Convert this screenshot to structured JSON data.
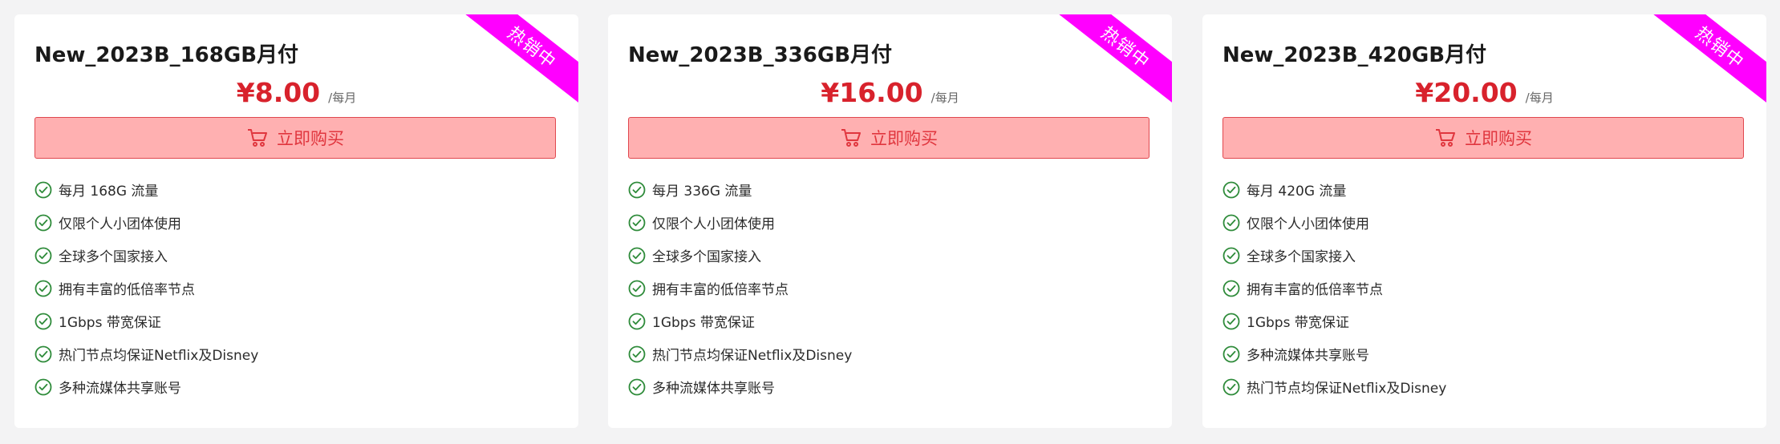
{
  "colors": {
    "accent": "#d8222c",
    "ribbon": "#ff00ff",
    "button_bg": "#ffb0b1",
    "check": "#2e8b3a"
  },
  "plans": [
    {
      "ribbon": "热销中",
      "title": "New_2023B_168GB月付",
      "price": "¥8.00",
      "unit": "/每月",
      "buy_label": "立即购买",
      "features": [
        "每月 168G 流量",
        "仅限个人小团体使用",
        "全球多个国家接入",
        "拥有丰富的低倍率节点",
        "1Gbps 带宽保证",
        "热门节点均保证Netflix及Disney",
        "多种流媒体共享账号"
      ]
    },
    {
      "ribbon": "热销中",
      "title": "New_2023B_336GB月付",
      "price": "¥16.00",
      "unit": "/每月",
      "buy_label": "立即购买",
      "features": [
        "每月 336G 流量",
        "仅限个人小团体使用",
        "全球多个国家接入",
        "拥有丰富的低倍率节点",
        "1Gbps 带宽保证",
        "热门节点均保证Netflix及Disney",
        "多种流媒体共享账号"
      ]
    },
    {
      "ribbon": "热销中",
      "title": "New_2023B_420GB月付",
      "price": "¥20.00",
      "unit": "/每月",
      "buy_label": "立即购买",
      "features": [
        "每月 420G 流量",
        "仅限个人小团体使用",
        "全球多个国家接入",
        "拥有丰富的低倍率节点",
        "1Gbps 带宽保证",
        "多种流媒体共享账号",
        "热门节点均保证Netflix及Disney"
      ]
    }
  ]
}
